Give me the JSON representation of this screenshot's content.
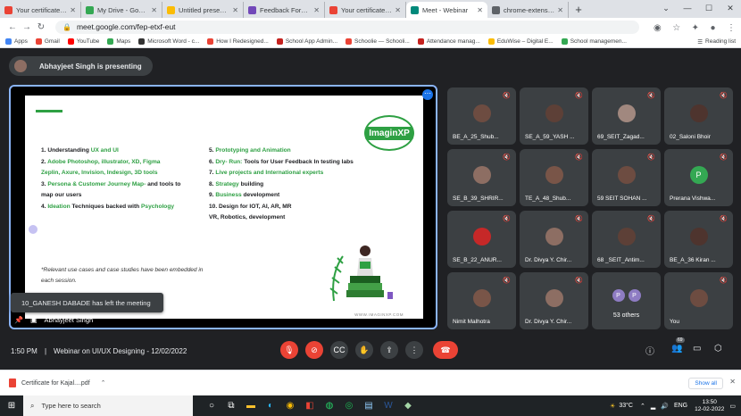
{
  "browser": {
    "tabs": [
      {
        "label": "Your certificate is here",
        "color": "#ea4335"
      },
      {
        "label": "My Drive - Google Drive",
        "color": "#34a853"
      },
      {
        "label": "Untitled presentation",
        "color": "#fbbc04"
      },
      {
        "label": "Feedback Form \" We...",
        "color": "#7248b9"
      },
      {
        "label": "Your certificate is here",
        "color": "#ea4335"
      },
      {
        "label": "Meet - Webinar",
        "color": "#00897b"
      },
      {
        "label": "chrome-extension://...",
        "color": "#5f6368"
      }
    ],
    "url": "meet.google.com/fep-etxf-eut",
    "bookmarks": [
      {
        "label": "Apps",
        "color": "#4285f4"
      },
      {
        "label": "Gmail",
        "color": "#ea4335"
      },
      {
        "label": "YouTube",
        "color": "#ff0000"
      },
      {
        "label": "Maps",
        "color": "#34a853"
      },
      {
        "label": "Microsoft Word - c...",
        "color": "#333333"
      },
      {
        "label": "How I Redesigned...",
        "color": "#ea4335"
      },
      {
        "label": "School App Admin...",
        "color": "#c5221f"
      },
      {
        "label": "Schoolie — Schooli...",
        "color": "#ea4335"
      },
      {
        "label": "Attendance manag...",
        "color": "#c5221f"
      },
      {
        "label": "EduWise – Digital E...",
        "color": "#fbbc04"
      },
      {
        "label": "School managemen...",
        "color": "#34a853"
      }
    ],
    "reading_list": "Reading list"
  },
  "meet": {
    "presenter_banner": "Abhayjeet Singh is presenting",
    "presenter_name": "Abhayjeet Singh",
    "toast": "10_GANESH DABADE has left the meeting",
    "time": "1:50 PM",
    "separator": "|",
    "meeting_title": "Webinar on UI/UX Designing - 12/02/2022",
    "participant_badge": "69",
    "slide": {
      "logo": "ImaginXP",
      "left": [
        {
          "n": "1. Understanding ",
          "g": "UX and UI",
          "t": ""
        },
        {
          "n": "2. ",
          "g": "Adobe Photoshop, illustrator, XD, Figma",
          "t": ""
        },
        {
          "n": "",
          "g": "Zeplin, Axure, Invision, Indesign, 3D tools",
          "t": ""
        },
        {
          "n": "3. ",
          "g": "Persona & Customer Journey Map-",
          "t": " and tools to"
        },
        {
          "n": "map our users",
          "g": "",
          "t": ""
        },
        {
          "n": "4. ",
          "g": "Ideation",
          "t": " Techniques backed with "
        },
        {
          "n": "",
          "g": "",
          "t": ""
        }
      ],
      "left_tail": "Psychology",
      "right": [
        {
          "n": "5. ",
          "g": "Prototyping and Animation",
          "t": ""
        },
        {
          "n": "6. ",
          "g": "Dry- Run:",
          "t": " Tools for User Feedback In testing labs"
        },
        {
          "n": "7. ",
          "g": "Live projects and International experts",
          "t": ""
        },
        {
          "n": "8. ",
          "g": "Strategy",
          "t": " building"
        },
        {
          "n": "9. ",
          "g": "Business",
          "t": " development"
        },
        {
          "n": "10. Design for IOT, AI, AR, MR",
          "g": "",
          "t": ""
        },
        {
          "n": "VR, Robotics, development",
          "g": "",
          "t": ""
        }
      ],
      "footnote": "*Relevant use cases and case studies have been embedded in each session.",
      "site": "WWW.IMAGINXP.COM"
    },
    "participants": [
      {
        "name": "BE_A_25_Shub...",
        "kind": "photo",
        "color": "#6d4c41"
      },
      {
        "name": "SE_A_59_YASH ...",
        "kind": "photo",
        "color": "#5d4037"
      },
      {
        "name": "69_SEIT_Zagad...",
        "kind": "photo",
        "color": "#a1887f"
      },
      {
        "name": "02_Saloni Bhoir",
        "kind": "photo",
        "color": "#4e342e"
      },
      {
        "name": "SE_B_39_SHRIR...",
        "kind": "photo",
        "color": "#8d6e63"
      },
      {
        "name": "TE_A_48_Shub...",
        "kind": "photo",
        "color": "#795548"
      },
      {
        "name": "59 SEIT SOHAN ...",
        "kind": "photo",
        "color": "#6d4c41"
      },
      {
        "name": "Prerana Vishwa...",
        "kind": "letter",
        "letter": "P",
        "color": "#34a853"
      },
      {
        "name": "SE_B_22_ANUR...",
        "kind": "photo",
        "color": "#c62828"
      },
      {
        "name": "Dr. Divya Y. Chir...",
        "kind": "photo",
        "color": "#8d6e63"
      },
      {
        "name": "68 _SEIT_Antim...",
        "kind": "photo",
        "color": "#5d4037"
      },
      {
        "name": "BE_A_36 Kiran ...",
        "kind": "photo",
        "color": "#4e342e"
      },
      {
        "name": "Nimit Malhotra",
        "kind": "photo",
        "color": "#795548"
      },
      {
        "name": "Dr. Divya Y. Chir...",
        "kind": "photo",
        "color": "#8d6e63"
      },
      {
        "name": "53 others",
        "kind": "others",
        "letters": [
          "P",
          "P"
        ],
        "color": "#8e7cc3"
      },
      {
        "name": "You",
        "kind": "photo",
        "color": "#6d4c41"
      }
    ]
  },
  "downloads": {
    "file": "Certificate for Kajal....pdf",
    "show_all": "Show all"
  },
  "taskbar": {
    "search_placeholder": "Type here to search",
    "weather": "33°C",
    "lang": "ENG",
    "time": "13:50",
    "date": "12-02-2022"
  }
}
